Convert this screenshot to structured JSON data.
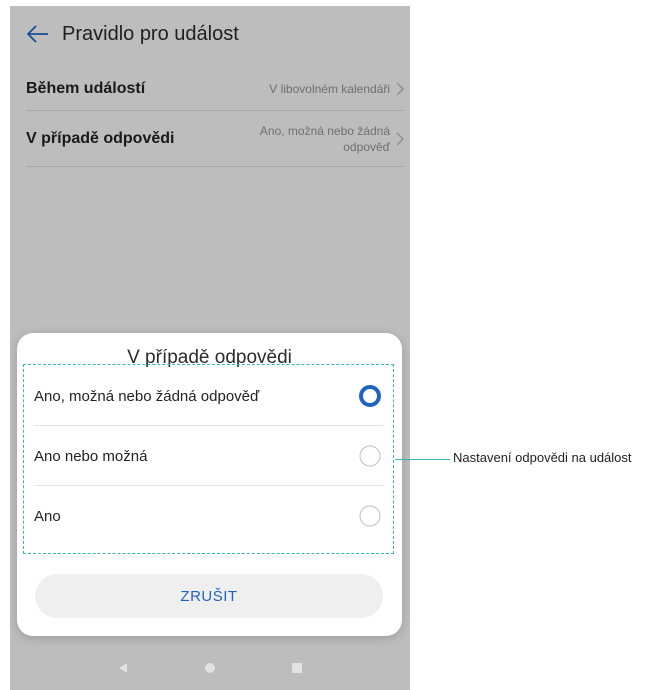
{
  "app_bar": {
    "title": "Pravidlo pro událost",
    "back_icon": "arrow-left-icon"
  },
  "settings": {
    "rows": [
      {
        "label": "Během událostí",
        "value": "V libovolném kalendáři"
      },
      {
        "label": "V případě odpovědi",
        "value": "Ano, možná nebo žádná odpověď"
      }
    ]
  },
  "dialog": {
    "title": "V případě odpovědi",
    "options": [
      {
        "label": "Ano, možná nebo žádná odpověď",
        "selected": true
      },
      {
        "label": "Ano nebo možná",
        "selected": false
      },
      {
        "label": "Ano",
        "selected": false
      }
    ],
    "cancel_label": "ZRUŠIT"
  },
  "annotation": {
    "text": "Nastavení odpovědi na událost"
  },
  "colors": {
    "accent": "#1f63c2",
    "dashed_highlight": "#3bb4b8",
    "background": "#f2f2f2"
  }
}
